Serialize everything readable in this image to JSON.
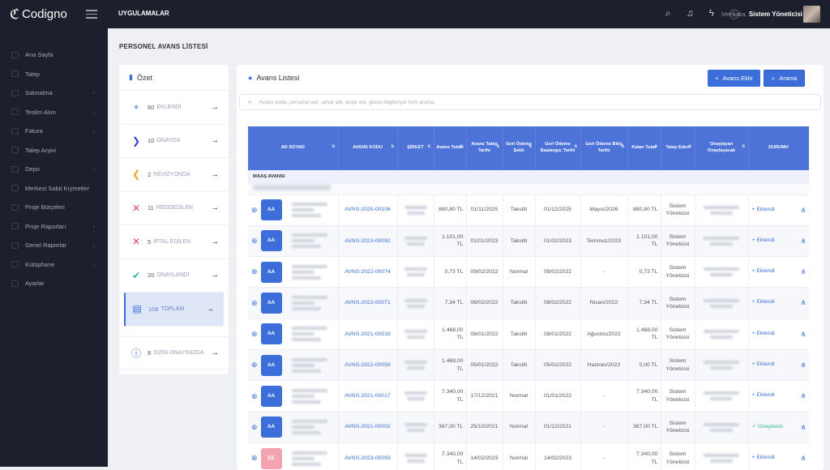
{
  "app": {
    "logo": "Codigno",
    "top_menu": "UYGULAMALAR",
    "greeting": "Merhaba,",
    "user": "Sistem Yöneticisi"
  },
  "sidebar": {
    "items": [
      "Ana Sayfa",
      "Talep",
      "Satınalma",
      "Teslim Alım",
      "Fatura",
      "Talep Arşivi",
      "Depo",
      "Merkezi Sabit Kıymetler",
      "Proje Bütçeleri",
      "Proje Raporları",
      "Genel Raporlar",
      "Kütüphane",
      "Ayarlar"
    ]
  },
  "page": {
    "title": "PERSONEL AVANS LİSTESİ"
  },
  "summary": {
    "title": "Özet",
    "items": [
      {
        "num": "60",
        "label": "EKLENDİ"
      },
      {
        "num": "10",
        "label": "ONAYDA"
      },
      {
        "num": "2",
        "label": "REVİZYONDA"
      },
      {
        "num": "11",
        "label": "REDDEDİLEN"
      },
      {
        "num": "5",
        "label": "İPTAL EDİLEN"
      },
      {
        "num": "20",
        "label": "ONAYLANDI"
      },
      {
        "num": "108",
        "label": "TOPLAM"
      },
      {
        "num": "8",
        "label": "SİZİN ONAYINIZDA"
      }
    ]
  },
  "list": {
    "title": "Avans Listesi",
    "add_label": "Avans Ekle",
    "search_label": "Arama",
    "search_placeholder": "Avans kodu, personel adı, şirket adı, proje adı, görev bilgileriyle hızlı arama",
    "headers": [
      "AD SOYAD",
      "AVANS KODU",
      "ŞİRKET",
      "Avans Tutarı",
      "Avans Talep Tarihi",
      "Geri Ödeme Şekli",
      "Geri Ödeme Başlangıç Tarihi",
      "Geri Ödeme Bitiş Tarihi",
      "Kalan Tutar",
      "Talep Eden",
      "Onaylayan Onaylayacak",
      "DURUMU"
    ],
    "group": "MAAŞ AVANSI",
    "rows": [
      {
        "initials": "AA",
        "code": "AVNS-2025-00106",
        "amount": "880,80 TL",
        "date": "01/11/2025",
        "pay": "Taksitli",
        "start": "01/12/2025",
        "end": "Mayıs/2026",
        "remain": "880,80 TL",
        "by": "Sistem Yöneticisi",
        "status": "Eklendi"
      },
      {
        "initials": "AA",
        "code": "AVNS-2023-00092",
        "amount": "1.101,00 TL",
        "date": "01/01/2023",
        "pay": "Taksitli",
        "start": "01/02/2023",
        "end": "Temmuz/2023",
        "remain": "1.101,00 TL",
        "by": "Sistem Yöneticisi",
        "status": "Eklendi"
      },
      {
        "initials": "AA",
        "code": "AVNS-2022-00074",
        "amount": "0,73 TL",
        "date": "09/02/2022",
        "pay": "Normal",
        "start": "09/02/2022",
        "end": "-",
        "remain": "0,73 TL",
        "by": "Sistem Yöneticisi",
        "status": "Eklendi"
      },
      {
        "initials": "AA",
        "code": "AVNS-2022-00071",
        "amount": "7,34 TL",
        "date": "08/02/2022",
        "pay": "Taksitli",
        "start": "08/02/2022",
        "end": "Nisan/2022",
        "remain": "7,34 TL",
        "by": "Sistem Yöneticisi",
        "status": "Eklendi"
      },
      {
        "initials": "AA",
        "code": "AVNS-2021-00018",
        "amount": "1.468,00 TL",
        "date": "08/01/2022",
        "pay": "Taksitli",
        "start": "08/01/2022",
        "end": "Ağustos/2022",
        "remain": "1.468,00 TL",
        "by": "Sistem Yöneticisi",
        "status": "Eklendi"
      },
      {
        "initials": "AA",
        "code": "AVNS-2022-00059",
        "amount": "1.468,00 TL",
        "date": "05/01/2022",
        "pay": "Taksitli",
        "start": "05/02/2022",
        "end": "Haziran/2022",
        "remain": "0,00 TL",
        "by": "Sistem Yöneticisi",
        "status": "Eklendi"
      },
      {
        "initials": "AA",
        "code": "AVNS-2021-00017",
        "amount": "7.340,00 TL",
        "date": "17/12/2021",
        "pay": "Normal",
        "start": "01/01/2022",
        "end": "-",
        "remain": "7.340,00 TL",
        "by": "Sistem Yöneticisi",
        "status": "Eklendi"
      },
      {
        "initials": "AA",
        "code": "AVNS-2021-00002",
        "amount": "367,00 TL",
        "date": "25/10/2021",
        "pay": "Normal",
        "start": "01/12/2021",
        "end": "-",
        "remain": "367,00 TL",
        "by": "Sistem Yöneticisi",
        "status": "Onaylandı"
      },
      {
        "initials": "EE",
        "code": "AVNS-2023-00093",
        "amount": "7.340,00 TL",
        "date": "14/02/2023",
        "pay": "Normal",
        "start": "14/02/2023",
        "end": "-",
        "remain": "7.340,00 TL",
        "by": "Sistem Yöneticisi",
        "status": "Eklendi"
      }
    ]
  }
}
